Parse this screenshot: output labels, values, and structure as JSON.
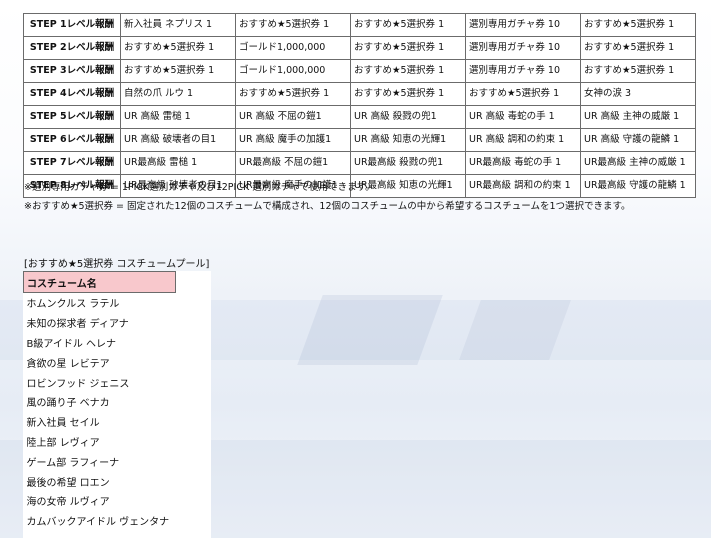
{
  "rewards": {
    "rows": [
      {
        "step": "STEP 1レベル報酬",
        "cells": [
          "新入社員 ネプリス 1",
          "おすすめ★5選択券 1",
          "おすすめ★5選択券 1",
          "選別専用ガチャ券 10",
          "おすすめ★5選択券 1"
        ]
      },
      {
        "step": "STEP 2レベル報酬",
        "cells": [
          "おすすめ★5選択券 1",
          "ゴールド1,000,000",
          "おすすめ★5選択券 1",
          "選別専用ガチャ券 10",
          "おすすめ★5選択券 1"
        ]
      },
      {
        "step": "STEP 3レベル報酬",
        "cells": [
          "おすすめ★5選択券 1",
          "ゴールド1,000,000",
          "おすすめ★5選択券 1",
          "選別専用ガチャ券 10",
          "おすすめ★5選択券 1"
        ]
      },
      {
        "step": "STEP 4レベル報酬",
        "cells": [
          "自然の爪 ルウ 1",
          "おすすめ★5選択券 1",
          "おすすめ★5選択券 1",
          "おすすめ★5選択券 1",
          "女神の涙 3"
        ]
      },
      {
        "step": "STEP 5レベル報酬",
        "cells": [
          "UR 高級 雷槌 1",
          "UR 高級 不屈の鎧1",
          "UR 高級 殺戮の兜1",
          "UR 高級 毒蛇の手 1",
          "UR 高級 主神の威厳 1"
        ]
      },
      {
        "step": "STEP 6レベル報酬",
        "cells": [
          "UR 高級 破壊者の目1",
          "UR 高級 魔手の加護1",
          "UR 高級 知恵の光輝1",
          "UR 高級 調和の約束 1",
          "UR 高級 守護の龍鱗 1"
        ]
      },
      {
        "step": "STEP 7レベル報酬",
        "cells": [
          "UR最高級 雷槌 1",
          "UR最高級 不屈の鎧1",
          "UR最高級 殺戮の兜1",
          "UR最高級 毒蛇の手 1",
          "UR最高級 主神の威厳 1"
        ]
      },
      {
        "step": "STEP 8レベル報酬",
        "cells": [
          "UR最高級 破壊者の目1",
          "UR最高級 魔手の加護1",
          "UR最高級 知恵の光輝1",
          "UR最高級 調和の約束 1",
          "UR最高級 守護の龍鱗 1"
        ]
      }
    ]
  },
  "notes": {
    "note1": "※選別専用ガチャ券 = 1PICK選別ガチャ及び12PICK 選別ガチャで使用できます。",
    "note2": "※おすすめ★5選択券 = 固定された12個のコスチュームで構成され、12個のコスチュームの中から希望するコスチュームを1つ選択できます。"
  },
  "pool": {
    "title": "[おすすめ★5選択券 コスチュームプール]",
    "header": "コスチューム名",
    "items": [
      "ホムンクルス ラテル",
      "未知の探求者 ディアナ",
      "B級アイドル ヘレナ",
      "貪欲の星 レビテア",
      "ロビンフッド ジェニス",
      "風の踊り子 ベナカ",
      "新入社員 セイル",
      "陸上部 レヴィア",
      "ゲーム部 ラフィーナ",
      "最後の希望 ロエン",
      "海の女帝 ルヴィア",
      "カムバックアイドル ヴェンタナ"
    ]
  },
  "colors": {
    "pool_header_bg": "#f8c8cc",
    "border": "#6b6b6b"
  }
}
